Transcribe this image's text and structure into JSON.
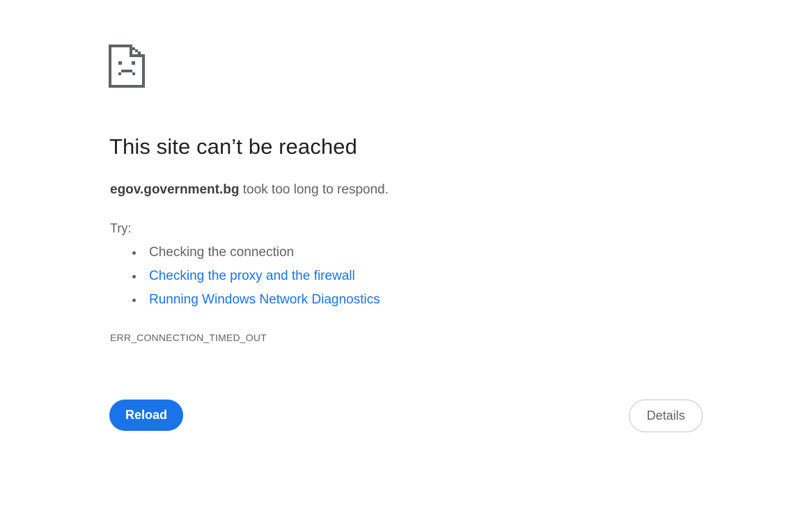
{
  "error_page": {
    "icon": "sad-document-icon",
    "title": "This site can’t be reached",
    "message": {
      "host": "egov.government.bg",
      "text": " took too long to respond."
    },
    "try_label": "Try:",
    "suggestions": [
      {
        "text": "Checking the connection",
        "is_link": false
      },
      {
        "text": "Checking the proxy and the firewall",
        "is_link": true
      },
      {
        "text": "Running Windows Network Diagnostics",
        "is_link": true
      }
    ],
    "error_code": "ERR_CONNECTION_TIMED_OUT",
    "buttons": {
      "reload_label": "Reload",
      "details_label": "Details"
    }
  },
  "colors": {
    "primary": "#1a73e8",
    "link": "#1a73e8",
    "text_secondary": "#5f6368",
    "text_primary": "#202124",
    "background": "#ffffff"
  }
}
